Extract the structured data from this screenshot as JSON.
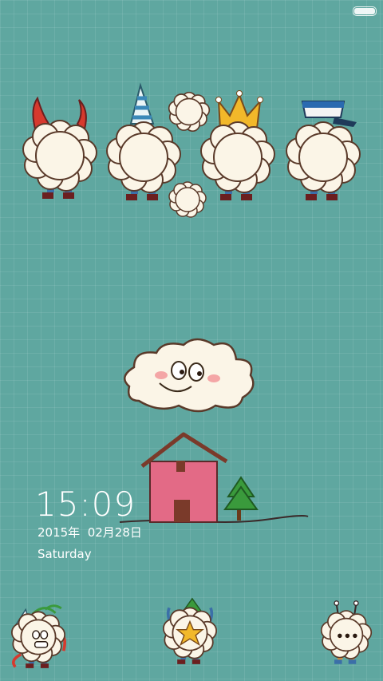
{
  "status_bar": {
    "battery_icon": "battery-icon"
  },
  "lockscreen": {
    "time": "15:09",
    "date": "2015年  02月28日",
    "weekday": "Saturday"
  },
  "colors": {
    "background": "#5fa7a0",
    "fluff": "#fbf5e7",
    "house": "#e36a86",
    "roof": "#7a3a2a",
    "tree": "#3a9a3c"
  }
}
